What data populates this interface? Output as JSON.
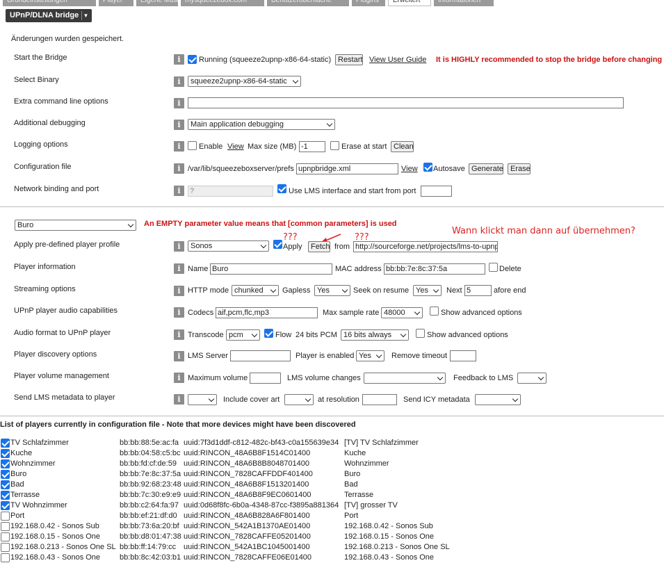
{
  "tabs": [
    {
      "label": "Grundeinstellungen"
    },
    {
      "label": "Player"
    },
    {
      "label": "Eigene Musik"
    },
    {
      "label": "mysqueezebox.com"
    },
    {
      "label": "Benutzeroberfläche"
    },
    {
      "label": "Plugins"
    },
    {
      "label": "Erweitert"
    },
    {
      "label": "Informationen"
    }
  ],
  "plugin_menu": {
    "label": "UPnP/DLNA bridge"
  },
  "saved_message": "Änderungen wurden gespeichert.",
  "info_glyph": "i",
  "settings": {
    "start_bridge": {
      "label": "Start the Bridge",
      "running_checked": true,
      "running_text": "Running (squeeze2upnp-x86-64-static)",
      "restart_button": "Restart",
      "guide_link": "View User Guide",
      "warning": "It is HIGHLY recommended to stop the bridge before changing"
    },
    "select_binary": {
      "label": "Select Binary",
      "value": "squeeze2upnp-x86-64-static"
    },
    "extra_options": {
      "label": "Extra command line options",
      "value": ""
    },
    "additional_debugging": {
      "label": "Additional debugging",
      "value": "Main application debugging"
    },
    "logging": {
      "label": "Logging options",
      "enable_label": "Enable",
      "enable_checked": false,
      "view_link": "View",
      "max_size_label": "Max size (MB)",
      "max_size_value": "-1",
      "erase_label": "Erase at start",
      "erase_checked": false,
      "clean_button": "Clean"
    },
    "config_file": {
      "label": "Configuration file",
      "path": "/var/lib/squeezeboxserver/prefs",
      "file_value": "upnpbridge.xml",
      "view_link": "View",
      "autosave_label": "Autosave",
      "autosave_checked": true,
      "generate_button": "Generate",
      "erase_button": "Erase"
    },
    "network": {
      "label": "Network binding and port",
      "binding_placeholder": "?",
      "use_lms_checked": true,
      "use_lms_label": "Use LMS interface and start from port",
      "port_value": ""
    }
  },
  "player_section": {
    "player_select": "Buro",
    "empty_notice": "An EMPTY parameter value means that [common parameters] is used",
    "annotations": {
      "q1": "???",
      "q2": "???",
      "hand_note": "Wann klickt man dann auf übernehmen?"
    },
    "profile": {
      "label": "Apply pre-defined player profile",
      "value": "Sonos",
      "apply_label": "Apply",
      "apply_checked": true,
      "fetch_button": "Fetch",
      "from_label": "from",
      "url": "http://sourceforge.net/projects/lms-to-upnp"
    },
    "player_info": {
      "label": "Player information",
      "name_label": "Name",
      "name_value": "Buro",
      "mac_label": "MAC address",
      "mac_value": "bb:bb:7e:8c:37:5a",
      "delete_label": "Delete",
      "delete_checked": false
    },
    "streaming": {
      "label": "Streaming options",
      "http_mode_label": "HTTP mode",
      "http_mode_value": "chunked",
      "gapless_label": "Gapless",
      "gapless_value": "Yes",
      "seek_label": "Seek on resume",
      "seek_value": "Yes",
      "next_label": "Next",
      "next_value": "5",
      "afore_end_label": "afore end"
    },
    "audio_caps": {
      "label": "UPnP player audio capabilities",
      "codecs_label": "Codecs",
      "codecs_value": "aif,pcm,flc,mp3",
      "max_rate_label": "Max sample rate",
      "max_rate_value": "48000",
      "show_adv_label": "Show advanced options",
      "show_adv_checked": false
    },
    "audio_format": {
      "label": "Audio format to UPnP player",
      "transcode_label": "Transcode",
      "transcode_value": "pcm",
      "flow_label": "Flow",
      "flow_checked": true,
      "bits_label": "24 bits PCM",
      "bits_value": "16 bits always",
      "show_adv_label": "Show advanced options",
      "show_adv_checked": false
    },
    "discovery": {
      "label": "Player discovery options",
      "lms_server_label": "LMS Server",
      "lms_server_value": "",
      "enabled_label": "Player is enabled",
      "enabled_value": "Yes",
      "remove_timeout_label": "Remove timeout",
      "remove_timeout_value": ""
    },
    "volume": {
      "label": "Player volume management",
      "max_volume_label": "Maximum volume",
      "max_volume_value": "",
      "lms_changes_label": "LMS volume changes",
      "lms_changes_value": "",
      "feedback_label": "Feedback to LMS",
      "feedback_value": ""
    },
    "metadata": {
      "label": "Send LMS metadata to player",
      "send_value": "",
      "cover_label": "Include cover art",
      "cover_value": "",
      "resolution_label": "at resolution",
      "resolution_value": "",
      "icy_label": "Send ICY metadata",
      "icy_value": ""
    }
  },
  "players_list": {
    "heading": "List of players currently in configuration file - Note that more devices might have been discovered",
    "rows": [
      {
        "checked": true,
        "name": "TV Schlafzimmer",
        "mac": "bb:bb:88:5e:ac:fa",
        "uuid": "uuid:7f3d1ddf-c812-482c-bf43-c0a155639e34",
        "friendly": "[TV] TV Schlafzimmer"
      },
      {
        "checked": true,
        "name": "Kuche",
        "mac": "bb:bb:04:58:c5:bc",
        "uuid": "uuid:RINCON_48A6B8F1514C01400",
        "friendly": "Kuche"
      },
      {
        "checked": true,
        "name": "Wohnzimmer",
        "mac": "bb:bb:fd:cf:de:59",
        "uuid": "uuid:RINCON_48A6B8B8048701400",
        "friendly": "Wohnzimmer"
      },
      {
        "checked": true,
        "name": "Buro",
        "mac": "bb:bb:7e:8c:37:5a",
        "uuid": "uuid:RINCON_7828CAFFDDF401400",
        "friendly": "Buro"
      },
      {
        "checked": true,
        "name": "Bad",
        "mac": "bb:bb:92:68:23:48",
        "uuid": "uuid:RINCON_48A6B8F1513201400",
        "friendly": "Bad"
      },
      {
        "checked": true,
        "name": "Terrasse",
        "mac": "bb:bb:7c:30:e9:e9",
        "uuid": "uuid:RINCON_48A6B8F9EC0601400",
        "friendly": "Terrasse"
      },
      {
        "checked": true,
        "name": "TV Wohnzimmer",
        "mac": "bb:bb:c2:64:fa:97",
        "uuid": "uuid:0d68f8fc-6b0a-4348-87cc-f3895a881364",
        "friendly": "[TV] grosser TV"
      },
      {
        "checked": false,
        "name": "Port",
        "mac": "bb:bb:ef:21:df:d0",
        "uuid": "uuid:RINCON_48A6B828A6F801400",
        "friendly": "Port"
      },
      {
        "checked": false,
        "name": "192.168.0.42 - Sonos Sub",
        "mac": "bb:bb:73:6a:20:bf",
        "uuid": "uuid:RINCON_542A1B1370AE01400",
        "friendly": "192.168.0.42 - Sonos Sub"
      },
      {
        "checked": false,
        "name": "192.168.0.15 - Sonos One",
        "mac": "bb:bb:d8:01:47:38",
        "uuid": "uuid:RINCON_7828CAFFE05201400",
        "friendly": "192.168.0.15 - Sonos One"
      },
      {
        "checked": false,
        "name": "192.168.0.213 - Sonos One SL",
        "mac": "bb:bb:ff:14:79:cc",
        "uuid": "uuid:RINCON_542A1BC1045001400",
        "friendly": "192.168.0.213 - Sonos One SL"
      },
      {
        "checked": false,
        "name": "192.168.0.43 - Sonos One",
        "mac": "bb:bb:8c:42:03:b1",
        "uuid": "uuid:RINCON_7828CAFFE06E01400",
        "friendly": "192.168.0.43 - Sonos One"
      }
    ]
  },
  "colors": {
    "accent": "#1a73e8",
    "warning": "#cc1111",
    "info_badge": "#8c8c8c"
  }
}
